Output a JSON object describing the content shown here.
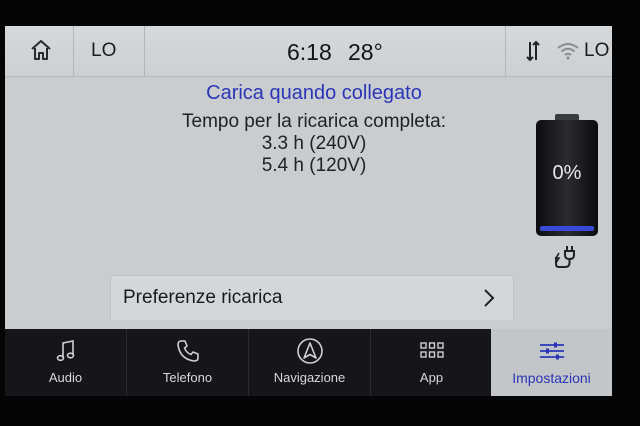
{
  "status_bar": {
    "home_icon": "home-icon",
    "fan_level_left": "LO",
    "time": "6:18",
    "temperature": "28°",
    "data_icon": "data-transfer-icon",
    "wifi_icon": "wifi-icon",
    "fan_level_right": "LO"
  },
  "charging": {
    "title": "Carica quando collegato",
    "time_label": "Tempo per la ricarica completa:",
    "time_240v": "3.3 h (240V)",
    "time_120v": "5.4 h (120V)",
    "battery_percent": "0%",
    "battery_level": 0,
    "plug_icon": "charging-plug-icon"
  },
  "preferences": {
    "label": "Preferenze ricarica",
    "chevron_icon": "chevron-right-icon"
  },
  "nav": {
    "items": [
      {
        "label": "Audio",
        "icon": "music-note-icon"
      },
      {
        "label": "Telefono",
        "icon": "phone-icon"
      },
      {
        "label": "Navigazione",
        "icon": "navigation-icon"
      },
      {
        "label": "App",
        "icon": "apps-grid-icon"
      },
      {
        "label": "Impostazioni",
        "icon": "settings-sliders-icon",
        "active": true
      }
    ]
  },
  "colors": {
    "accent": "#2a36b8",
    "nav_background": "#16161a",
    "screen_background": "#c9cdcf",
    "battery_glow": "#3a4ad8"
  }
}
